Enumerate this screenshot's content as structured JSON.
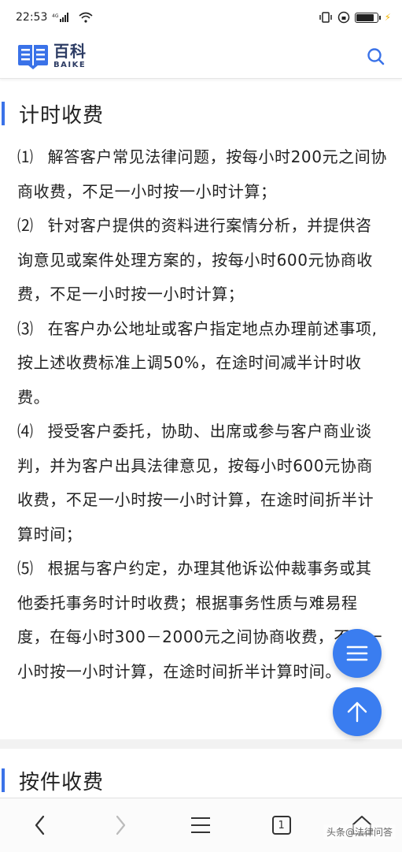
{
  "status_bar": {
    "time": "22:53",
    "signal_text": "4G"
  },
  "header": {
    "logo_cn": "百科",
    "logo_en": "BAIKE"
  },
  "sections": [
    {
      "title": "计时收费"
    },
    {
      "title": "按件收费"
    }
  ],
  "paragraphs": [
    {
      "num": "⑴",
      "text": "解答客户常见法律问题，按每小时200元之间协商收费，不足一小时按一小时计算；"
    },
    {
      "num": "⑵",
      "text": "针对客户提供的资料进行案情分析，并提供咨询意见或案件处理方案的，按每小时600元协商收费，不足一小时按一小时计算；"
    },
    {
      "num": "⑶",
      "text": "在客户办公地址或客户指定地点办理前述事项,按上述收费标准上调50%，在途时间减半计时收费。"
    },
    {
      "num": "⑷",
      "text": "授受客户委托，协助、出席或参与客户商业谈判，并为客户出具法律意见，按每小时600元协商收费，不足一小时按一小时计算，在途时间折半计算时间；"
    },
    {
      "num": "⑸",
      "text": "根据与客户约定，办理其他诉讼仲裁事务或其他委托事务时计时收费；根据事务性质与难易程度，在每小时300－2000元之间协商收费，不足一小时按一小时计算，在途时间折半计算时间。"
    }
  ],
  "bottom_nav": {
    "tab_count": "1"
  },
  "watermark": "头条@法律问答",
  "colors": {
    "accent": "#3a72e8",
    "fab": "#3a7df0",
    "logo": "#2d3c64"
  },
  "icons": [
    "search-icon",
    "menu-lines-icon",
    "arrow-up-icon",
    "back-icon",
    "forward-icon",
    "menu-icon",
    "tabs-icon",
    "home-icon"
  ]
}
